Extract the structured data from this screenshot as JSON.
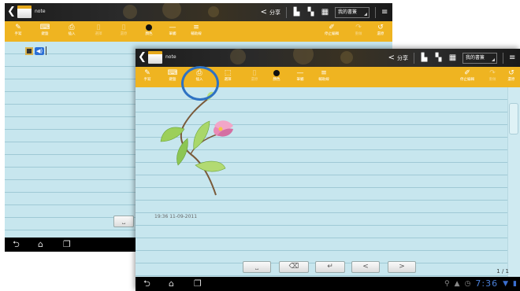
{
  "back": {
    "title": "note",
    "share": "分享",
    "notebook": "我的書簽",
    "toolbar": [
      "手寫",
      "鍵盤",
      "插入",
      "選擇",
      "還原",
      "顏色",
      "筆觸",
      "輔助線",
      "停止編輯",
      "重做",
      "還原"
    ]
  },
  "front": {
    "title": "note",
    "share": "分享",
    "notebook": "我的書簽",
    "toolbar": [
      "手寫",
      "鍵盤",
      "插入",
      "選擇",
      "還原",
      "顏色",
      "筆觸",
      "輔助線",
      "停止編輯",
      "重做",
      "還原"
    ],
    "timestamp": "19:36 11-09-2011",
    "page": "1 / 1",
    "clock": "7:36"
  },
  "accents": {
    "toolbar": "#efb421",
    "paper": "#c7e6ee",
    "highlight": "#2e72c3"
  },
  "icons": [
    "back-arrow-icon",
    "share-icon",
    "page-export-icon",
    "page-icon",
    "grid-icon",
    "menu-icon",
    "home-icon",
    "recent-apps-icon",
    "back-nav-icon",
    "film-icon",
    "speaker-icon"
  ]
}
